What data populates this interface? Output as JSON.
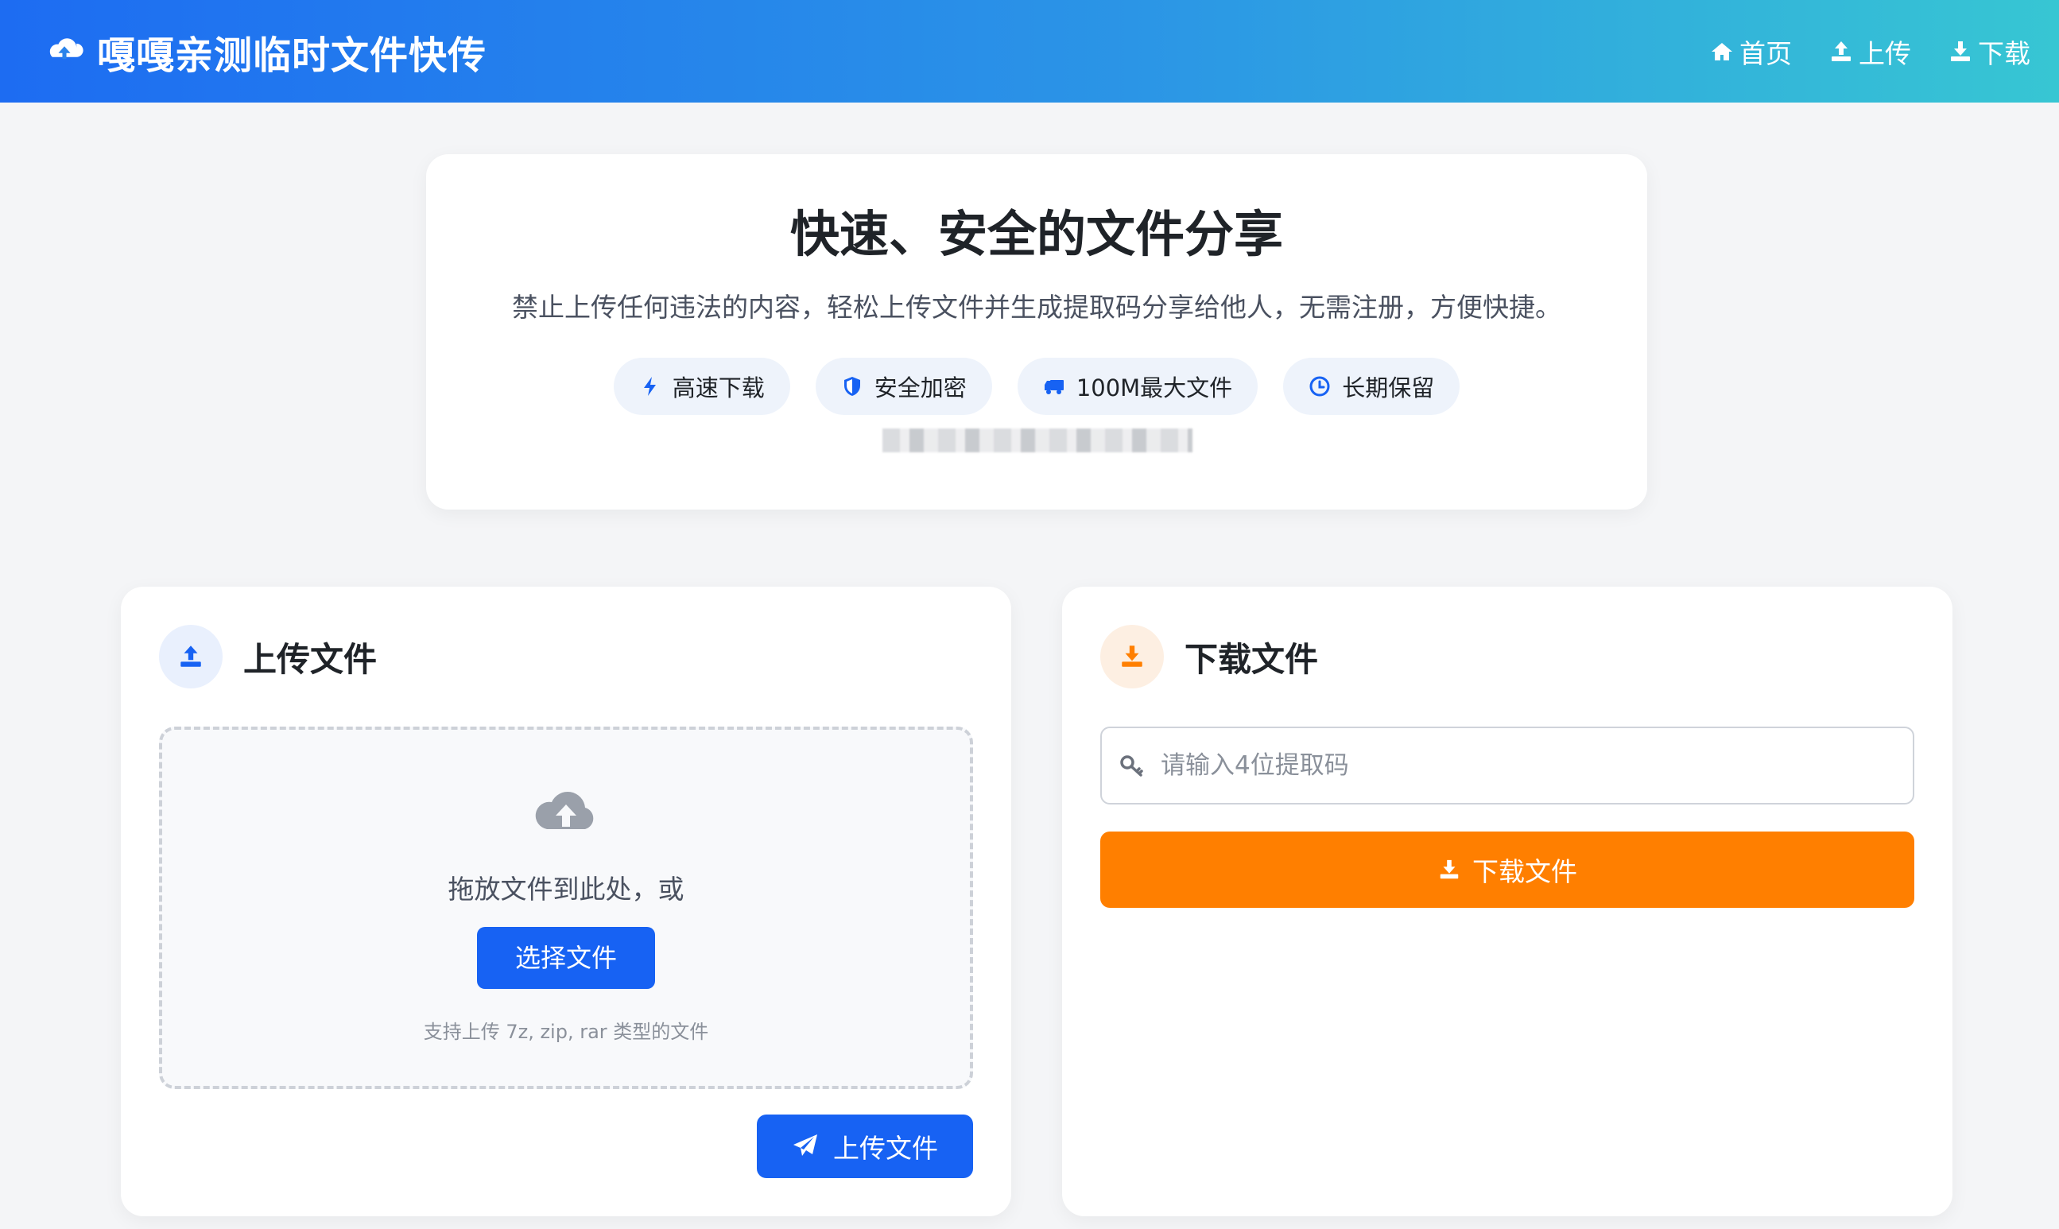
{
  "header": {
    "title": "嘎嘎亲测临时文件快传",
    "brand_icon": "cloud-upload-icon",
    "nav": [
      {
        "label": "首页",
        "icon": "home-icon"
      },
      {
        "label": "上传",
        "icon": "upload-icon"
      },
      {
        "label": "下载",
        "icon": "download-icon"
      }
    ]
  },
  "hero": {
    "title": "快速、安全的文件分享",
    "description": "禁止上传任何违法的内容，轻松上传文件并生成提取码分享给他人，无需注册，方便快捷。",
    "badges": [
      {
        "label": "高速下载",
        "icon": "bolt-icon"
      },
      {
        "label": "安全加密",
        "icon": "shield-icon"
      },
      {
        "label": "100M最大文件",
        "icon": "truck-icon"
      },
      {
        "label": "长期保留",
        "icon": "clock-icon"
      }
    ]
  },
  "upload": {
    "title": "上传文件",
    "drop_text": "拖放文件到此处，或",
    "choose_label": "选择文件",
    "support_text": "支持上传 7z, zip, rar 类型的文件",
    "submit_label": "上传文件"
  },
  "download": {
    "title": "下载文件",
    "input_placeholder": "请输入4位提取码",
    "input_value": "",
    "submit_label": "下载文件"
  },
  "colors": {
    "primary": "#1762f3",
    "accent": "#ff7f00",
    "header_start": "#1d6cf2",
    "header_end": "#37c6d3"
  }
}
